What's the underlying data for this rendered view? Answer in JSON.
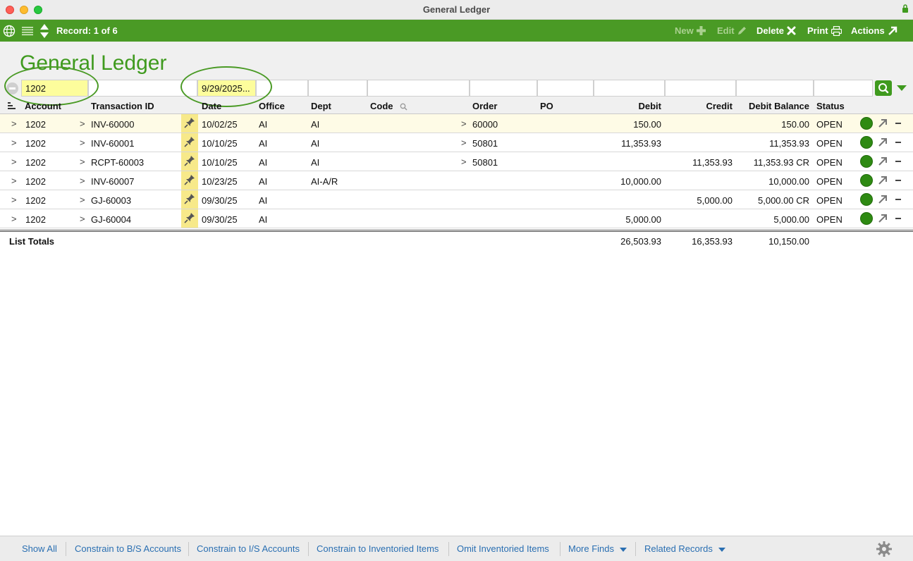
{
  "window": {
    "title": "General Ledger"
  },
  "toolbar": {
    "record_label": "Record: 1 of 6",
    "new_label": "New",
    "edit_label": "Edit",
    "delete_label": "Delete",
    "print_label": "Print",
    "actions_label": "Actions"
  },
  "page": {
    "title": "General Ledger"
  },
  "find": {
    "account": "1202",
    "date": "9/29/2025..."
  },
  "columns": {
    "account": "Account",
    "transaction_id": "Transaction ID",
    "date": "Date",
    "office": "Office",
    "dept": "Dept",
    "code": "Code",
    "order": "Order",
    "po": "PO",
    "debit": "Debit",
    "credit": "Credit",
    "debit_balance": "Debit Balance",
    "status": "Status"
  },
  "rows": [
    {
      "account": "1202",
      "transaction_id": "INV-60000",
      "date": "10/02/25",
      "office": "AI",
      "dept": "AI",
      "order": "60000",
      "debit": "150.00",
      "credit": "",
      "balance": "150.00",
      "status": "OPEN"
    },
    {
      "account": "1202",
      "transaction_id": "INV-60001",
      "date": "10/10/25",
      "office": "AI",
      "dept": "AI",
      "order": "50801",
      "debit": "11,353.93",
      "credit": "",
      "balance": "11,353.93",
      "status": "OPEN"
    },
    {
      "account": "1202",
      "transaction_id": "RCPT-60003",
      "date": "10/10/25",
      "office": "AI",
      "dept": "AI",
      "order": "50801",
      "debit": "",
      "credit": "11,353.93",
      "balance": "11,353.93 CR",
      "status": "OPEN"
    },
    {
      "account": "1202",
      "transaction_id": "INV-60007",
      "date": "10/23/25",
      "office": "AI",
      "dept": "AI-A/R",
      "order": "",
      "debit": "10,000.00",
      "credit": "",
      "balance": "10,000.00",
      "status": "OPEN"
    },
    {
      "account": "1202",
      "transaction_id": "GJ-60003",
      "date": "09/30/25",
      "office": "AI",
      "dept": "",
      "order": "",
      "debit": "",
      "credit": "5,000.00",
      "balance": "5,000.00 CR",
      "status": "OPEN"
    },
    {
      "account": "1202",
      "transaction_id": "GJ-60004",
      "date": "09/30/25",
      "office": "AI",
      "dept": "",
      "order": "",
      "debit": "5,000.00",
      "credit": "",
      "balance": "5,000.00",
      "status": "OPEN"
    }
  ],
  "totals": {
    "label": "List Totals",
    "debit": "26,503.93",
    "credit": "16,353.93",
    "balance": "10,150.00"
  },
  "footer": {
    "show_all": "Show All",
    "constrain_bs": "Constrain to B/S Accounts",
    "constrain_is": "Constrain to I/S Accounts",
    "constrain_inv": "Constrain to Inventoried Items",
    "omit_inv": "Omit Inventoried Items",
    "more_finds": "More Finds",
    "related_records": "Related Records"
  },
  "colors": {
    "brand_green": "#4a9a25",
    "status_open": "#2e8a12",
    "link_blue": "#2a6fb2",
    "find_yellow": "#fdfd9c"
  },
  "icons": [
    "globe-icon",
    "list-icon",
    "sort-arrows-icon",
    "plus-icon",
    "pencil-icon",
    "x-icon",
    "printer-icon",
    "arrow-out-icon",
    "pin-icon",
    "search-icon",
    "gear-icon",
    "lock-icon"
  ]
}
